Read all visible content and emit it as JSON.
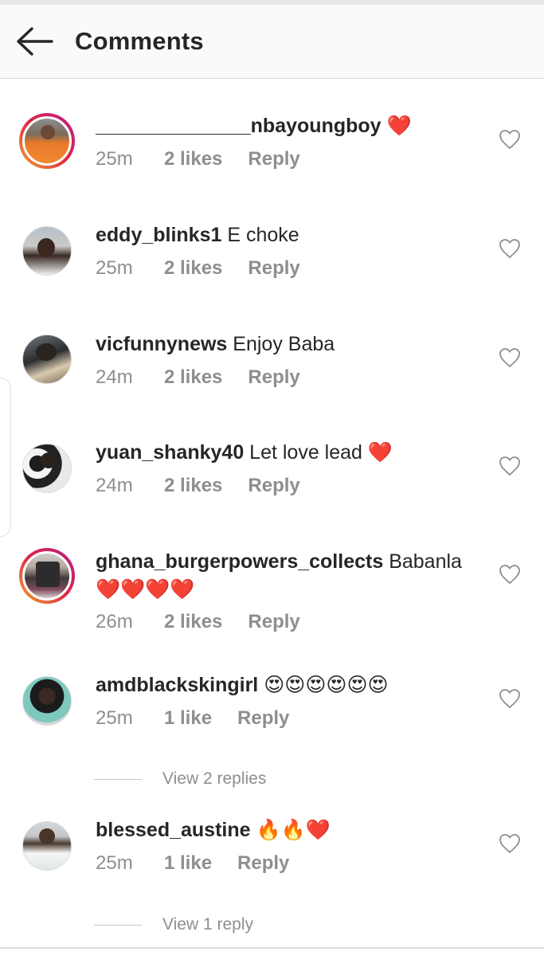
{
  "header": {
    "title": "Comments",
    "back_icon": "arrow-left-icon"
  },
  "comments": [
    {
      "username": "______________nbayoungboy",
      "text": "",
      "emoji": "❤️",
      "time": "25m",
      "likes": "2 likes",
      "reply": "Reply",
      "story_ring": true
    },
    {
      "username": "eddy_blinks1",
      "text": "E choke",
      "emoji": "",
      "time": "25m",
      "likes": "2 likes",
      "reply": "Reply",
      "story_ring": false
    },
    {
      "username": "vicfunnynews",
      "text": "Enjoy Baba",
      "emoji": "",
      "time": "24m",
      "likes": "2 likes",
      "reply": "Reply",
      "story_ring": false
    },
    {
      "username": "yuan_shanky40",
      "text": "Let love lead",
      "emoji": "❤️",
      "time": "24m",
      "likes": "2 likes",
      "reply": "Reply",
      "story_ring": false
    },
    {
      "username": "ghana_burgerpowers_collects",
      "text": "Babanla",
      "emoji": "❤️❤️❤️❤️",
      "time": "26m",
      "likes": "2 likes",
      "reply": "Reply",
      "story_ring": true
    },
    {
      "username": "amdblackskingirl",
      "text": "",
      "emoji": "😍😍😍😍😍😍",
      "time": "25m",
      "likes": "1 like",
      "reply": "Reply",
      "story_ring": false,
      "view_replies": "View 2 replies"
    },
    {
      "username": "blessed_austine",
      "text": "",
      "emoji": "🔥🔥❤️",
      "time": "25m",
      "likes": "1 like",
      "reply": "Reply",
      "story_ring": false,
      "view_replies": "View 1 reply"
    }
  ],
  "colors": {
    "text": "#262626",
    "muted": "#8e8e8e",
    "heart": "#e8202a",
    "divider": "#dbdbdb"
  }
}
